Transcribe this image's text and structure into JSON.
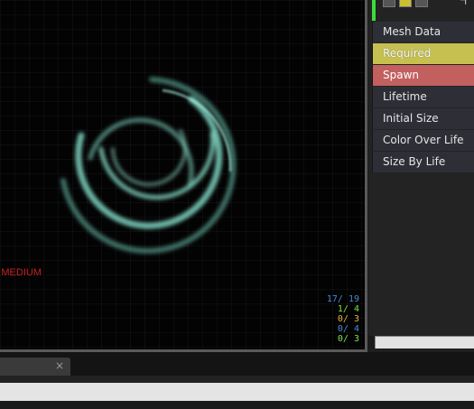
{
  "viewport": {
    "lod_label": "E MEDIUM",
    "stats": [
      {
        "text": "17/ 19",
        "color": "#4a8bd6"
      },
      {
        "text": "1/ 4",
        "color": "#7ee24a"
      },
      {
        "text": "0/ 3",
        "color": "#e2b43a"
      },
      {
        "text": "0/ 4",
        "color": "#4a8bd6"
      },
      {
        "text": "0/ 3",
        "color": "#7ee24a"
      }
    ],
    "particle_color": "#7ee0c8"
  },
  "emitter": {
    "modules": [
      {
        "label": "Mesh Data"
      },
      {
        "label": "Required"
      },
      {
        "label": "Spawn"
      },
      {
        "label": "Lifetime"
      },
      {
        "label": "Initial Size"
      },
      {
        "label": "Color Over Life"
      },
      {
        "label": "Size By Life"
      }
    ],
    "toolbar_right": "ㄱ"
  },
  "tab": {
    "close": "×"
  }
}
